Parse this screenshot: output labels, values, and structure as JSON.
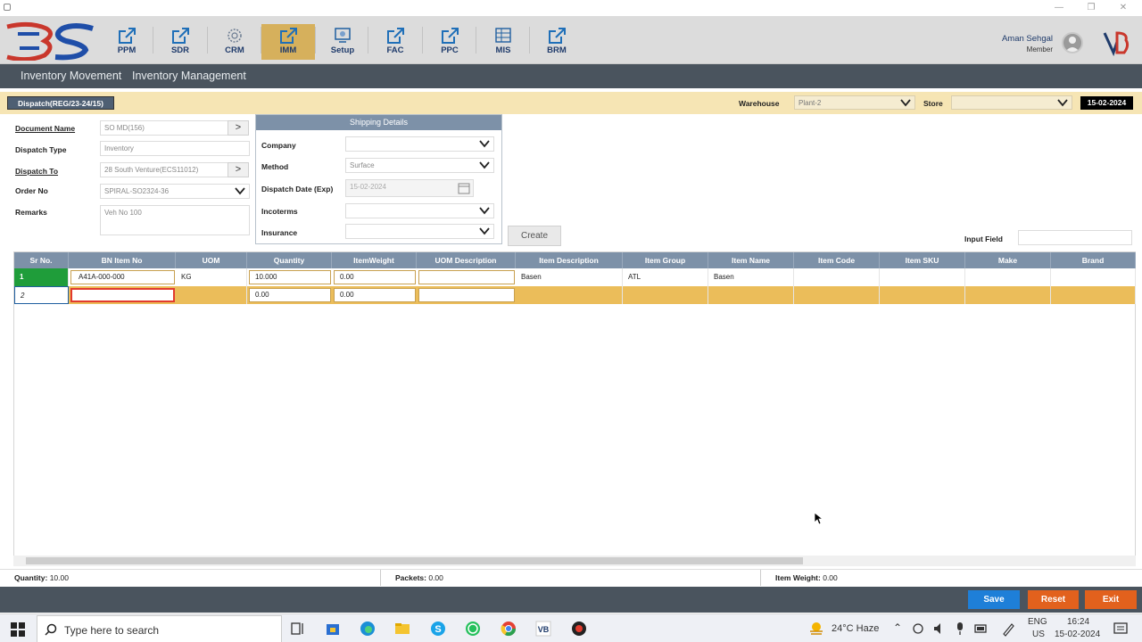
{
  "window": {
    "minimize_icon": "minimize-icon",
    "maximize_icon": "maximize-icon",
    "close_icon": "close-icon",
    "close_glyph": "✕",
    "minimize_glyph": "—",
    "maximize_glyph": "❐"
  },
  "nav": {
    "modules": [
      {
        "label": "PPM",
        "icon": "share-box-icon"
      },
      {
        "label": "SDR",
        "icon": "share-box-icon"
      },
      {
        "label": "CRM",
        "icon": "crm-globe-icon"
      },
      {
        "label": "IMM",
        "icon": "share-box-icon",
        "active": true
      },
      {
        "label": "Setup",
        "icon": "setup-icon"
      },
      {
        "label": "FAC",
        "icon": "share-box-icon"
      },
      {
        "label": "PPC",
        "icon": "share-box-icon"
      },
      {
        "label": "MIS",
        "icon": "mis-grid-icon"
      },
      {
        "label": "BRM",
        "icon": "share-box-icon"
      }
    ],
    "user_name": "Aman Sehgal",
    "user_role": "Member"
  },
  "menu": {
    "items": [
      "Inventory Movement",
      "Inventory Management"
    ]
  },
  "module_bar": {
    "title": "Dispatch(REG/23-24/15)",
    "warehouse_label": "Warehouse",
    "warehouse_value": "Plant-2",
    "store_label": "Store",
    "store_value": "",
    "date": "15-02-2024"
  },
  "form": {
    "document_name_label": "Document Name",
    "document_name_value": "SO MD(156)",
    "dispatch_type_label": "Dispatch Type",
    "dispatch_type_value": "Inventory",
    "dispatch_to_label": "Dispatch To",
    "dispatch_to_value": "28 South Venture(ECS11012)",
    "order_no_label": "Order No",
    "order_no_value": "SPIRAL-SO2324-36",
    "remarks_label": "Remarks",
    "remarks_value": "Veh No 100",
    "arrow": ">"
  },
  "shipping": {
    "title": "Shipping Details",
    "company_label": "Company",
    "company_value": "",
    "method_label": "Method",
    "method_value": "Surface",
    "dispatch_date_label": "Dispatch Date (Exp)",
    "dispatch_date_value": "15-02-2024",
    "incoterms_label": "Incoterms",
    "incoterms_value": "",
    "insurance_label": "Insurance",
    "insurance_value": ""
  },
  "create_label": "Create",
  "input_field_label": "Input Field",
  "input_field_value": "",
  "grid": {
    "headers": [
      "Sr No.",
      "BN Item No",
      "UOM",
      "Quantity",
      "ItemWeight",
      "UOM Description",
      "Item Description",
      "Item Group",
      "Item Name",
      "Item Code",
      "Item SKU",
      "Make",
      "Brand"
    ],
    "rows": [
      {
        "sr": "1",
        "bn": "A41A-000-000",
        "uom": "KG",
        "qty": "10.000",
        "weight": "0.00",
        "uom_desc": "",
        "item_desc": "Basen",
        "group": "ATL",
        "name": "Basen",
        "code": "",
        "sku": "",
        "make": "",
        "brand": ""
      },
      {
        "sr": "2",
        "bn": "",
        "uom": "",
        "qty": "0.00",
        "weight": "0.00",
        "uom_desc": "",
        "item_desc": "",
        "group": "",
        "name": "",
        "code": "",
        "sku": "",
        "make": "",
        "brand": ""
      }
    ]
  },
  "summary": {
    "quantity_label": "Quantity:",
    "quantity_value": "10.00",
    "packets_label": "Packets:",
    "packets_value": "0.00",
    "weight_label": "Item Weight:",
    "weight_value": "0.00"
  },
  "actions": {
    "save": "Save",
    "reset": "Reset",
    "exit": "Exit"
  },
  "colors": {
    "save": "#1e7fd8",
    "reset": "#e2611d",
    "exit": "#e2611d",
    "active_row": "#ebbd5a",
    "header": "#7d91a8"
  },
  "taskbar": {
    "search_placeholder": "Type here to search",
    "weather": "24°C  Haze",
    "lang_top": "ENG",
    "lang_bottom": "US",
    "time": "16:24",
    "date": "15-02-2024"
  }
}
